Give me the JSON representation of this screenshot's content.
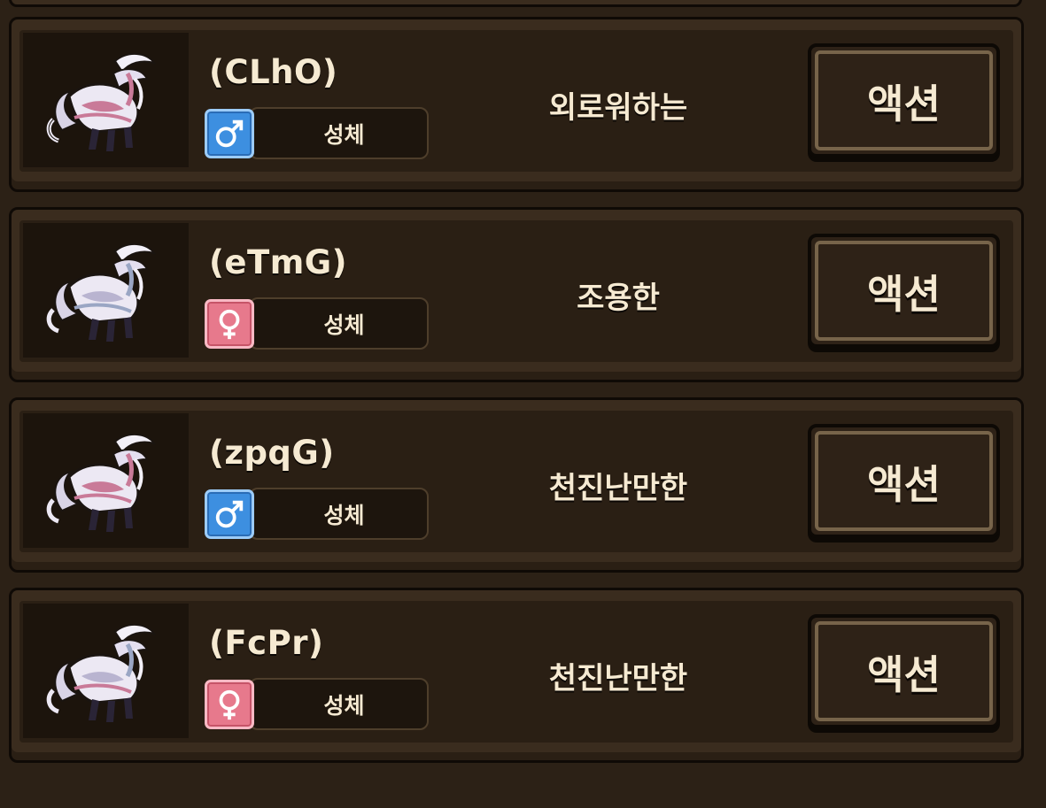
{
  "colors": {
    "background": "#2c2116",
    "card": "#3a2c1e",
    "text": "#f6ead2",
    "male": "#3d8fe0",
    "female": "#e7798c"
  },
  "list": {
    "items": [
      {
        "name": "(CLhO)",
        "gender": "male",
        "gender_icon": "male-symbol-icon",
        "type": "성체",
        "nature": "외로워하는",
        "action_label": "액션",
        "portrait_icon": "dragon-creature-sprite"
      },
      {
        "name": "(eTmG)",
        "gender": "female",
        "gender_icon": "female-symbol-icon",
        "type": "성체",
        "nature": "조용한",
        "action_label": "액션",
        "portrait_icon": "dragon-creature-sprite"
      },
      {
        "name": "(zpqG)",
        "gender": "male",
        "gender_icon": "male-symbol-icon",
        "type": "성체",
        "nature": "천진난만한",
        "action_label": "액션",
        "portrait_icon": "dragon-creature-sprite"
      },
      {
        "name": "(FcPr)",
        "gender": "female",
        "gender_icon": "female-symbol-icon",
        "type": "성체",
        "nature": "천진난만한",
        "action_label": "액션",
        "portrait_icon": "dragon-creature-sprite"
      }
    ]
  }
}
